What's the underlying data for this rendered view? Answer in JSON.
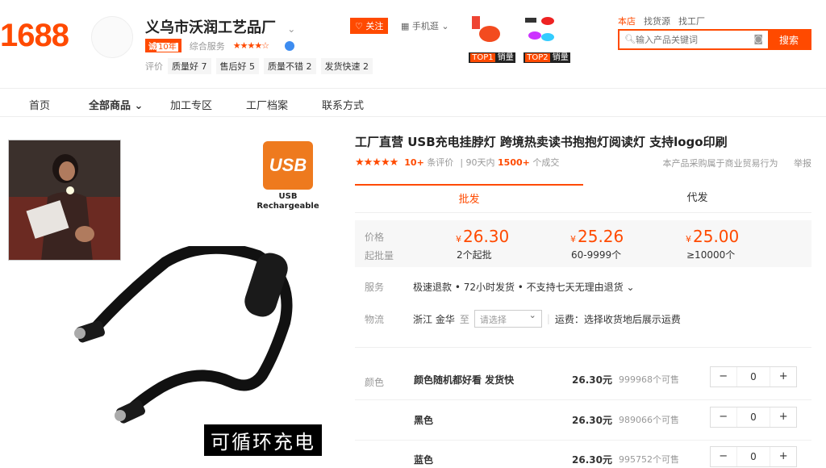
{
  "header": {
    "logo": "1688",
    "shop_name": "义乌市沃润工艺品厂",
    "shop_chevron": "⌄",
    "cert_badge_prefix": "诚",
    "cert_badge_years": "10年",
    "composite_service_label": "综合服务",
    "stars": "★★★★☆",
    "eval_label": "评价",
    "eval_tags": [
      "质量好 7",
      "售后好 5",
      "质量不错 2",
      "发货快速 2"
    ],
    "follow_label": "♡ 关注",
    "mobile_label": "▦ 手机逛 ⌄",
    "top_thumbs": [
      {
        "rank": "TOP1",
        "tag": "销量"
      },
      {
        "rank": "TOP2",
        "tag": "销量"
      }
    ],
    "search_tabs": [
      "本店",
      "找货源",
      "找工厂"
    ],
    "search_placeholder": "输入产品关键词",
    "search_button": "搜索"
  },
  "nav": {
    "items": [
      "首页",
      "全部商品 ⌄",
      "加工专区",
      "工厂档案",
      "联系方式"
    ]
  },
  "gallery": {
    "usb_badge": "USB",
    "usb_caption": "USB\nRechargeable",
    "overlay_text": "可循环充电"
  },
  "product": {
    "title": "工厂直营 USB充电挂脖灯 跨境热卖读书抱抱灯阅读灯 支持logo印刷",
    "stars": "★★★★★",
    "review_count": "10+",
    "review_label": "条评价",
    "sales_label_pre": "90天内",
    "sales_count": "1500+",
    "sales_label_post": "个成交",
    "notice": "本产品采购属于商业贸易行为",
    "report": "举报",
    "tabs": [
      "批发",
      "代发"
    ],
    "price_label": "价格",
    "moq_label": "起批量",
    "currency": "¥",
    "tiers": [
      {
        "price": "26.30",
        "range": "2个起批"
      },
      {
        "price": "25.26",
        "range": "60-9999个"
      },
      {
        "price": "25.00",
        "range": "≥10000个"
      }
    ],
    "service_label": "服务",
    "service_text": "极速退款 • 72小时发货 • 不支持七天无理由退货 ⌄",
    "logistics_label": "物流",
    "origin": "浙江 金华",
    "to_label": "至",
    "dest_placeholder": "请选择",
    "shipping_note": "运费：选择收货地后展示运费",
    "color_label": "颜色",
    "variants": [
      {
        "name": "颜色随机都好看 发货快",
        "price": "26.30元",
        "stock": "999968个可售",
        "qty": "0"
      },
      {
        "name": "黑色",
        "price": "26.30元",
        "stock": "989066个可售",
        "qty": "0"
      },
      {
        "name": "蓝色",
        "price": "26.30元",
        "stock": "995752个可售",
        "qty": "0"
      }
    ],
    "minus": "−",
    "plus": "+"
  }
}
